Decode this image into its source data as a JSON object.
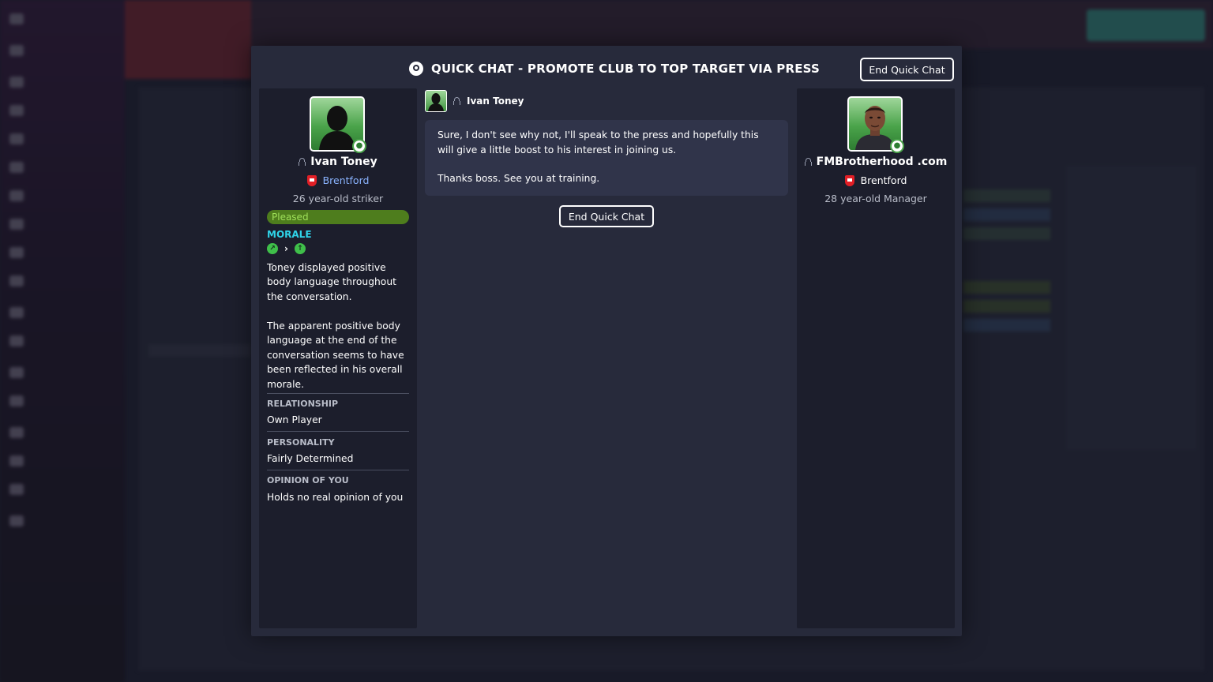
{
  "modal": {
    "title": "QUICK CHAT - PROMOTE CLUB TO TOP TARGET VIA PRESS",
    "end_chat_top": "End Quick Chat",
    "end_chat_mid": "End Quick Chat"
  },
  "player": {
    "name": "Ivan Toney",
    "club": "Brentford",
    "subtitle": "26 year-old striker",
    "mood": "Pleased",
    "morale_label": "MORALE",
    "desc1": "Toney displayed positive body language throughout the conversation.",
    "desc2": "The apparent positive body language at the end of the conversation seems to have been reflected in his overall morale.",
    "relationship_label": "RELATIONSHIP",
    "relationship_value": "Own Player",
    "personality_label": "PERSONALITY",
    "personality_value": "Fairly Determined",
    "opinion_label": "OPINION OF YOU",
    "opinion_value": "Holds no real opinion of you"
  },
  "manager": {
    "name": "FMBrotherhood .com",
    "club": "Brentford",
    "subtitle": "28 year-old Manager"
  },
  "message": {
    "author": "Ivan Toney",
    "line1": "Sure, I don't see why not, I'll speak to the press and hopefully this will give a little boost to his interest in joining us.",
    "line2": "Thanks boss. See you at training."
  },
  "colors": {
    "accent_cyan": "#2fd3e8",
    "mood_green": "#4e7d1d",
    "club_red": "#e21f26"
  }
}
